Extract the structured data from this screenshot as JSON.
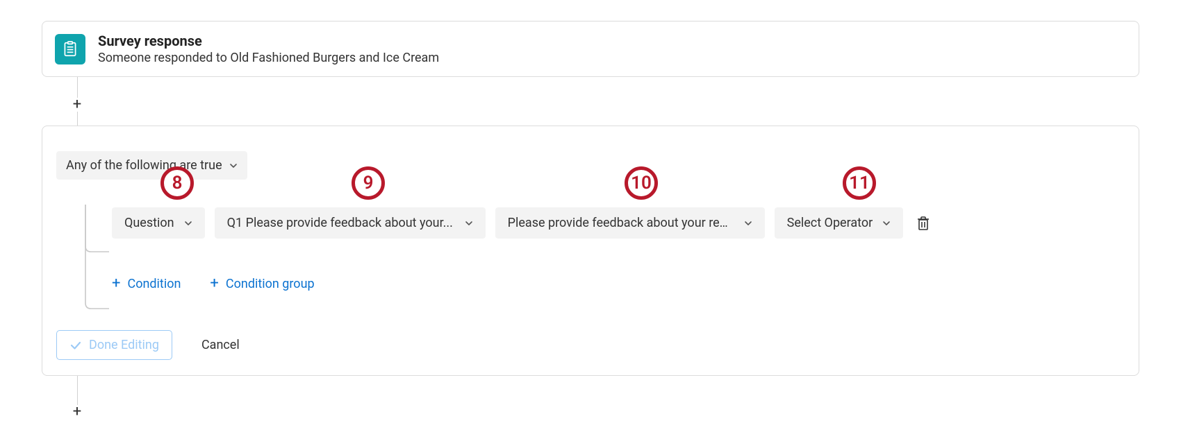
{
  "trigger": {
    "title": "Survey response",
    "description": "Someone responded to Old Fashioned Burgers and Ice Cream"
  },
  "editor": {
    "group_mode": "Any of the following are true",
    "condition": {
      "type_label": "Question",
      "question_label": "Q1 Please provide feedback about your...",
      "field_label": "Please provide feedback about your res...",
      "operator_label": "Select Operator"
    },
    "add_condition_label": "Condition",
    "add_group_label": "Condition group",
    "done_label": "Done Editing",
    "cancel_label": "Cancel"
  },
  "callouts": {
    "c8": "8",
    "c9": "9",
    "c10": "10",
    "c11": "11"
  }
}
